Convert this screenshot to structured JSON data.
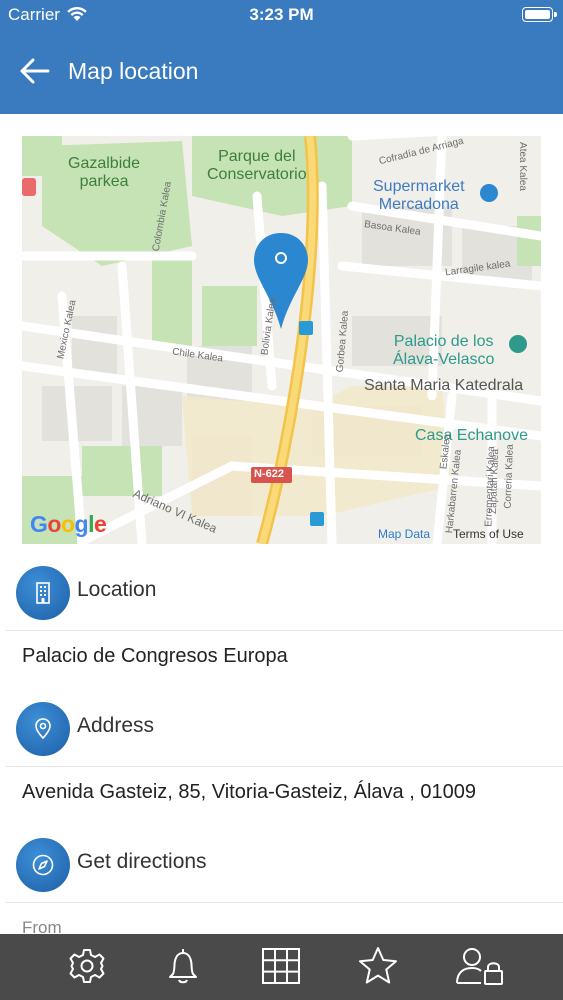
{
  "status_bar": {
    "carrier": "Carrier",
    "time": "3:23 PM"
  },
  "header": {
    "title": "Map location"
  },
  "map": {
    "labels": {
      "gazalbide": "Gazalbide\nparkea",
      "parque": "Parque del\nConservatorio",
      "supermarket": "Supermarket\nMercadona",
      "palacio": "Palacio de los\nÁlava-Velasco",
      "katedrala": "Santa Maria Katedrala",
      "casa": "Casa Echanove",
      "n622": "N-622"
    },
    "streets": {
      "cofradia": "Cofradía de Arriaga",
      "atea": "Atea Kalea",
      "colombia": "Colombia Kalea",
      "basoa": "Basoa Kalea",
      "larragile": "Larragile kalea",
      "mexico": "Mexico Kalea",
      "chile": "Chile Kalea",
      "bolivia": "Bolivia Kalea",
      "gorbea": "Gorbea Kalea",
      "adriano": "Adriano VI Kalea",
      "correria": "Correria Kalea",
      "zapatari": "Zapatari Kalea",
      "errementari": "Errementari Kalea",
      "harkabarren": "Harkabarren Kalea",
      "eskalea": "Eskalea"
    },
    "google": "Google",
    "map_data": "Map Data",
    "terms": "Terms of Use"
  },
  "location": {
    "title": "Location",
    "value": "Palacio de Congresos Europa"
  },
  "address": {
    "title": "Address",
    "value": "Avenida Gasteiz, 85, Vitoria-Gasteiz, Álava , 01009"
  },
  "directions": {
    "title": "Get directions",
    "from_label": "From"
  },
  "tabbar": [
    "settings",
    "notifications",
    "grid",
    "favorites",
    "user-lock"
  ]
}
